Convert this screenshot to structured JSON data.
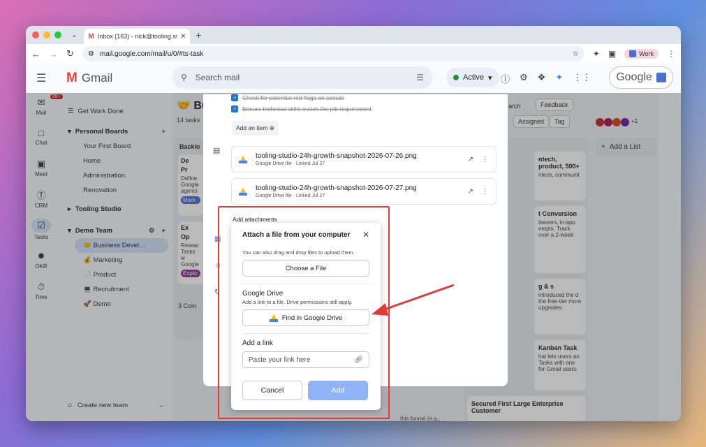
{
  "browser": {
    "tab_title": "Inbox (163) - nick@tooling.st…",
    "url": "mail.google.com/mail/u/0/#ts-task",
    "profile": "Work"
  },
  "gmail": {
    "product": "Gmail",
    "search_placeholder": "Search mail",
    "status": "Active",
    "account_label": "Google"
  },
  "rail": [
    {
      "label": "Mail",
      "icon": "mail-icon",
      "badge": "99+"
    },
    {
      "label": "Chat",
      "icon": "chat-icon"
    },
    {
      "label": "Meet",
      "icon": "video-icon"
    },
    {
      "label": "CRM",
      "icon": "dollar-icon"
    },
    {
      "label": "Tasks",
      "icon": "tasks-icon"
    },
    {
      "label": "OKR",
      "icon": "okr-icon"
    },
    {
      "label": "Time",
      "icon": "timer-icon"
    }
  ],
  "sidebar": {
    "get_work_done": "Get Work Done",
    "personal_boards": "Personal Boards",
    "personal_items": [
      "Your First Board",
      "Home",
      "Administration",
      "Renovation"
    ],
    "tooling_studio": "Tooling Studio",
    "demo_team": "Demo Team",
    "demo_items": [
      "🤝 Business Devel…",
      "💰 Marketing",
      "📄 Product",
      "💻 Recruitment",
      "🚀 Demo"
    ],
    "create_team": "Create new team"
  },
  "board": {
    "title_partial": "🤝 Bus",
    "tasks_count": "14 tasks",
    "backlog": "Backlo",
    "search_partial": "arch",
    "feedback": "Feedback",
    "assigned": "Assigned",
    "tag": "Tag",
    "more_count": "+1",
    "add_list": "Add a List",
    "comments": "3 Com",
    "card_texts": [
      "De",
      "Pr",
      "Define",
      "Google",
      "agenci",
      "Mark",
      "Ex",
      "Op",
      "Resear",
      "Tasks w",
      "Google",
      "Explo",
      "ntech, product, 500+",
      "ntech, communit",
      "t Conversion",
      "teasers, in-app empts. Track over a 2-week",
      "g & s",
      "introduced the d the free-tier more upgrades.",
      "Kanban Task",
      "hat lets users an Tasks with one for Gmail users.",
      "Secured First Large Enterprise Customer",
      "this funnel (e.g.,"
    ]
  },
  "task_panel": {
    "checklist": [
      "Check for potential red flags on socials",
      "Ensure technical skills match the job requirement"
    ],
    "add_item": "Add an item",
    "attachments": [
      {
        "name": "tooling-studio-24h-growth-snapshot-2026-07-26.png",
        "meta": "Google Drive file · Linked Jul 27"
      },
      {
        "name": "tooling-studio-24h-growth-snapshot-2026-07-27.png",
        "meta": "Google Drive file · Linked Jul 27"
      }
    ]
  },
  "popup": {
    "section_title": "Add attachments",
    "computer_title": "Attach a file from your computer",
    "computer_note": "You can also drag and drop files to upload them.",
    "choose_file": "Choose a File",
    "drive_title": "Google Drive",
    "drive_note": "Add a link to a file. Drive permissions still apply.",
    "find_drive": "Find in Google Drive",
    "link_title": "Add a link",
    "link_placeholder": "Paste your link here",
    "cancel": "Cancel",
    "add": "Add"
  },
  "colors": {
    "highlight": "#e53935",
    "primary": "#1a73e8",
    "add_disabled": "#8fb3f7"
  }
}
